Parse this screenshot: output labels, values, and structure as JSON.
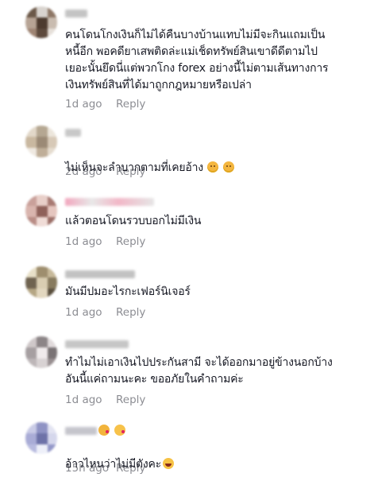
{
  "comments": [
    {
      "avatar_colors": [
        "#6b5848",
        "#d9d4cf",
        "#8e7766",
        "#b7a495",
        "#4d3b2f",
        "#c9bcb0",
        "#9e8473",
        "#5d4a3d",
        "#e6e0da"
      ],
      "username_color": "#c4c4c4",
      "text": "คนโดนโกงเงินก็ไม่ได้คืนบางบ้านแทบไม่มีจะกินแถมเป็น\nหนี้อีก พอคดียาเสพติดล่ะแม่เช็ดทรัพย์สินเขาดีดีตามไป\nเยอะนั้นยึดนี่แต่พวกโกง forex อย่างนี้ไม่ตามเส้นทางการ\nเงินทรัพย์สินที่ได้มาถูกกฎหมายหรือเปล่า",
      "time": "1d ago",
      "reply": "Reply"
    },
    {
      "avatar_colors": [
        "#e2d8c9",
        "#b5a792",
        "#ece6dc",
        "#c9b8a0",
        "#9b8a76",
        "#d7c9b7",
        "#efe9e1",
        "#bfae98",
        "#e5dccf"
      ],
      "username_color": "#c8c8c8",
      "text": "ไม่เห็นจะลำบากตามที่เคยอ้าง",
      "emojis": [
        "disappointed-emoji",
        "worried-emoji"
      ],
      "time": "2d ago",
      "reply": "Reply"
    },
    {
      "avatar_colors": [
        "#c9a09a",
        "#e8cfc9",
        "#a87a73",
        "#d9b5ae",
        "#8f615a",
        "#e5c6bf",
        "#b98d86",
        "#f0dcd7",
        "#9c6f68"
      ],
      "username_color": "#f2b7c7",
      "text": "แล้วตอนโดนรวบบอกไม่มีเงิน",
      "time": "1d ago",
      "reply": "Reply"
    },
    {
      "avatar_colors": [
        "#e8e0c8",
        "#9e8e6e",
        "#c7b99a",
        "#6f6350",
        "#d9cdb2",
        "#877a5e",
        "#b5a684",
        "#e2d7bf",
        "#5a4f3e"
      ],
      "username_color": "#c2c2c2",
      "text": "มันมีปมอะไรกะเฟอร์นิเจอร์",
      "time": "1d ago",
      "reply": "Reply"
    },
    {
      "avatar_colors": [
        "#cfc8c9",
        "#8c8587",
        "#e1dbdc",
        "#a69fa1",
        "#f0ebec",
        "#7a7375",
        "#bdb6b8",
        "#d8d2d3",
        "#988f91"
      ],
      "username_color": "#c6c6c6",
      "text": "ทำไมไม่เอาเงินไปประกันสามี จะได้ออกมาอยู่ข้างนอกบ้าง\nอันนี้แค่ถามนะคะ ขออภัยในคำถามค่ะ",
      "time": "1d ago",
      "reply": "Reply"
    },
    {
      "avatar_colors": [
        "#c9cbe6",
        "#8f93c4",
        "#e3e4f2",
        "#a9acd6",
        "#6d72a8",
        "#d5d7ec",
        "#b8bbdf",
        "#eef0f9",
        "#9498c9"
      ],
      "username_color": "#c5c5cc",
      "text": "อ้าวไหนว่าไม่มีตังคะ",
      "emojis": [
        "laughing-emoji"
      ],
      "time": "15h ago",
      "reply": "Reply"
    }
  ]
}
